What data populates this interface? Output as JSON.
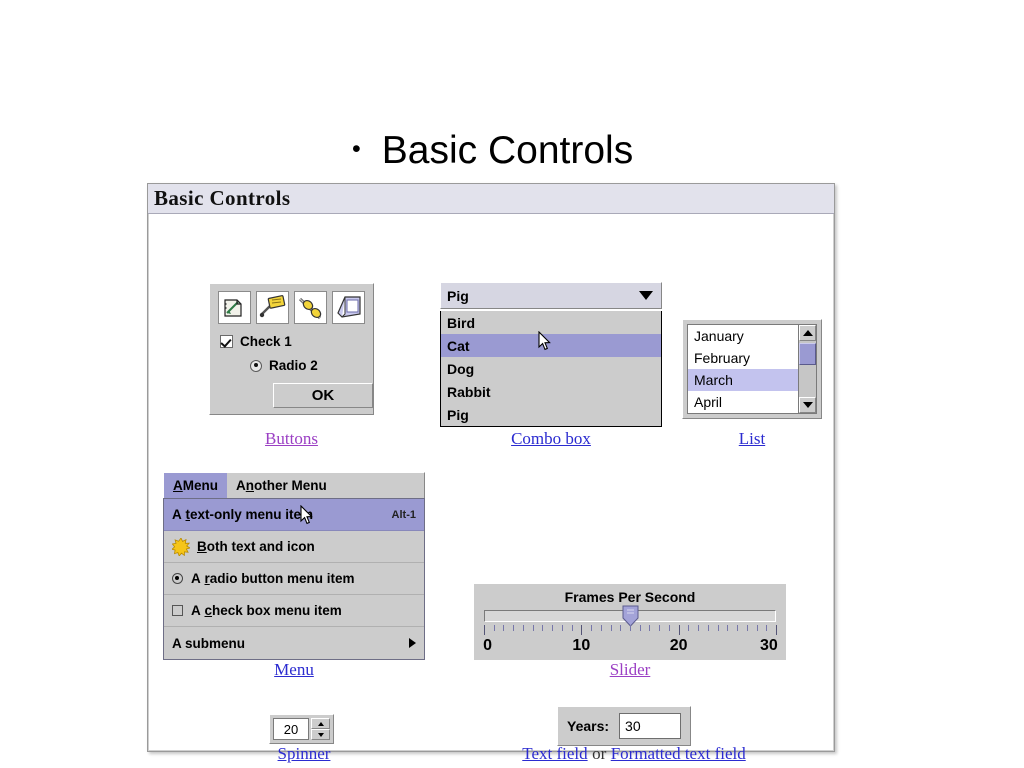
{
  "slide": {
    "bullet": "•",
    "title": "Basic Controls"
  },
  "window": {
    "title": "Basic Controls"
  },
  "buttons_panel": {
    "caption": "Buttons",
    "toolbar_icons": [
      "pencil-draw-icon",
      "note-tag-icon",
      "chain-link-icon",
      "page-book-icon"
    ],
    "checkbox": {
      "label": "Check 1",
      "checked": true
    },
    "radio": {
      "label": "Radio 2",
      "selected": true
    },
    "ok_button": "OK"
  },
  "combo": {
    "caption": "Combo box",
    "selected": "Pig",
    "options": [
      "Bird",
      "Cat",
      "Dog",
      "Rabbit",
      "Pig"
    ],
    "hovered": "Cat",
    "arrow_icon": "chevron-down-icon"
  },
  "list": {
    "caption": "List",
    "items": [
      "January",
      "February",
      "March",
      "April"
    ],
    "selected": "March",
    "scroll_up_icon": "triangle-up-icon",
    "scroll_down_icon": "triangle-down-icon"
  },
  "menu": {
    "caption": "Menu",
    "menubar": [
      {
        "label": "A Menu",
        "mnemonic": "A",
        "active": true
      },
      {
        "label": "Another Menu",
        "mnemonic": "n",
        "active": false
      }
    ],
    "items": [
      {
        "label": "A text-only menu item",
        "mnemonic": "t",
        "accel": "Alt-1",
        "highlighted": true,
        "kind": "text"
      },
      {
        "label": "Both text and icon",
        "mnemonic": "B",
        "accel": "",
        "highlighted": false,
        "kind": "icon",
        "icon": "sun-burst-icon"
      },
      {
        "label": "A radio button menu item",
        "mnemonic": "r",
        "accel": "",
        "highlighted": false,
        "kind": "radio",
        "selected": true
      },
      {
        "label": "A check box menu item",
        "mnemonic": "c",
        "accel": "",
        "highlighted": false,
        "kind": "check",
        "checked": false
      },
      {
        "label": "A submenu",
        "mnemonic": "",
        "accel": "",
        "highlighted": false,
        "kind": "submenu",
        "arrow_icon": "triangle-right-icon"
      }
    ]
  },
  "slider": {
    "caption": "Slider",
    "title": "Frames Per Second",
    "value": 15,
    "min": 0,
    "max": 30,
    "major_ticks": [
      0,
      10,
      20,
      30
    ],
    "tick_labels": [
      "0",
      "10",
      "20",
      "30"
    ]
  },
  "spinner": {
    "caption": "Spinner",
    "value": "20",
    "up_icon": "triangle-up-icon",
    "down_icon": "triangle-down-icon"
  },
  "textfield": {
    "label": "Years:",
    "value": "30",
    "caption_left": "Text field",
    "caption_sep": "or",
    "caption_right": "Formatted text field"
  },
  "colors": {
    "panel_gray": "#cccccc",
    "highlight_purple": "#9a9ad2",
    "list_select": "#c3c3ee",
    "titlebar": "#e2e2ec",
    "link_blue": "#2b2bd0",
    "link_purple": "#9b3fc4"
  }
}
